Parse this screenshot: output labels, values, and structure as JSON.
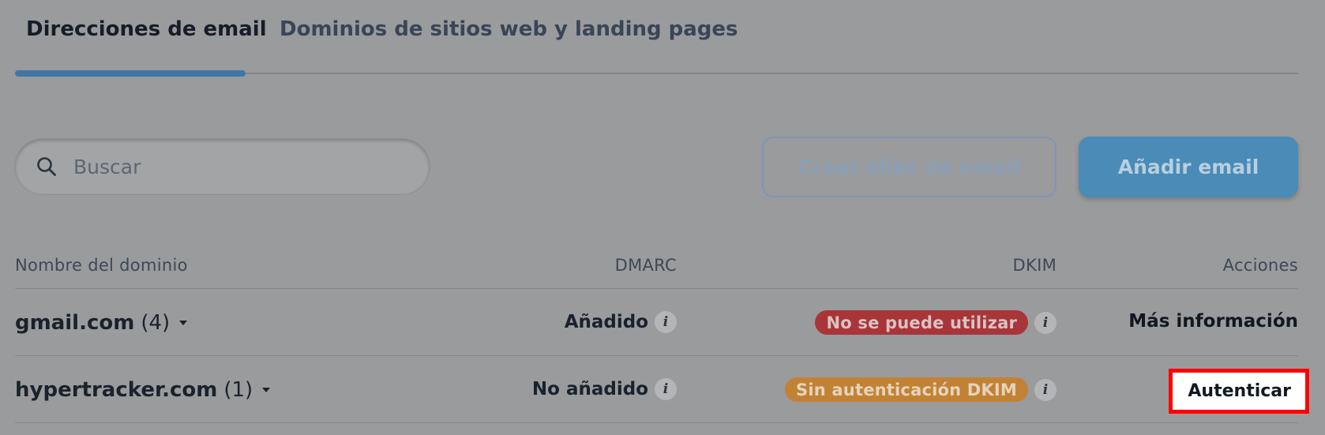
{
  "tabs": [
    {
      "label": "Direcciones de email",
      "active": true
    },
    {
      "label": "Dominios de sitios web y landing pages",
      "active": false
    }
  ],
  "search": {
    "placeholder": "Buscar",
    "icon": "search-icon"
  },
  "buttons": {
    "create_alias": "Crear alias de email",
    "add_email": "Añadir email"
  },
  "table": {
    "headers": {
      "name": "Nombre del dominio",
      "dmarc": "DMARC",
      "dkim": "DKIM",
      "actions": "Acciones"
    },
    "rows": [
      {
        "domain": "gmail.com",
        "count": "(4)",
        "dmarc": "Añadido",
        "dkim": "No se puede utilizar",
        "dkim_status_color": "#a8353a",
        "action": "Más información"
      },
      {
        "domain": "hypertracker.com",
        "count": "(1)",
        "dmarc": "No añadido",
        "dkim": "Sin autenticación DKIM",
        "dkim_status_color": "#c28235",
        "action": "Autenticar"
      }
    ]
  },
  "colors": {
    "accent": "#3e77a7",
    "highlight": "#ff0000"
  }
}
